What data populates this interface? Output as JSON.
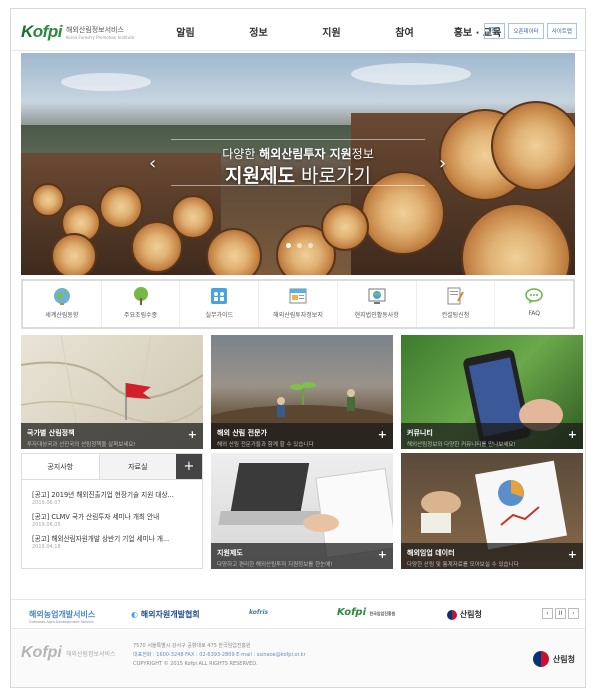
{
  "header": {
    "logo_word_k": "K",
    "logo_word_rest": "ofpi",
    "logo_sub1": "해외산림정보서비스",
    "logo_sub2": "Korea Forestry Promotion Institute",
    "menu": [
      "알림",
      "정보",
      "지원",
      "참여",
      "홍보 · 교육"
    ],
    "utils": [
      "ENG",
      "오픈데이터",
      "사이트맵"
    ]
  },
  "hero": {
    "line1_pre": "다양한 ",
    "line1_bold": "해외산림투자 지원",
    "line1_post": "정보",
    "line2_bold": "지원제도",
    "line2_post": " 바로가기",
    "prev": "‹",
    "next": "›"
  },
  "quick": [
    {
      "label": "세계산림동향",
      "icon": "globe-icon"
    },
    {
      "label": "주요조림수종",
      "icon": "tree-icon"
    },
    {
      "label": "실무가이드",
      "icon": "guide-people-icon"
    },
    {
      "label": "해외산림투자정보지",
      "icon": "newsletter-icon"
    },
    {
      "label": "현지법인활동사항",
      "icon": "local-office-icon"
    },
    {
      "label": "컨설팅신청",
      "icon": "consulting-icon"
    },
    {
      "label": "FAQ",
      "icon": "faq-bubble-icon"
    }
  ],
  "tiles": {
    "t1": {
      "title": "국가별 산림정책",
      "desc": "투자대상국과 선진국의 산림정책을 살펴보세요!"
    },
    "t2": {
      "title": "해외 산림 전문가",
      "desc": "해외 산림 전문가들과 함께 할 수 있습니다"
    },
    "t3": {
      "title": "커뮤니티",
      "desc": "해외산림정보와 다양한 커뮤니티를 만나보세요!"
    },
    "t4": {
      "title": "지원제도",
      "desc": "다양하고 편리한 해외산림투자 지원정보를 한눈에!"
    },
    "t5": {
      "title": "해외임업 데이터",
      "desc": "다양한 산림 및 통계자료를 모아보실 수 있습니다"
    },
    "plus": "+"
  },
  "notice": {
    "tab_on": "공지사항",
    "tab_off": "자료실",
    "plus": "+",
    "items": [
      {
        "title": "[공고] 2019년 해외진출기업 현장기술 지원 대상...",
        "date": "2019.06.07"
      },
      {
        "title": "[공고] CLMV 국가 산림투자 세미나 개최 안내",
        "date": "2019.06.05"
      },
      {
        "title": "[공고] 해외산림자원개발 상반기 기업 세미나 개...",
        "date": "2019.04.18"
      }
    ]
  },
  "partners": {
    "p1": "해외농업개발서비스",
    "p1_sub": "Overseas Agro-Development Service",
    "p2": "해외자원개발협회",
    "p3": "kofris",
    "p4": "Kofpi",
    "p4_sub": "한국임업진흥원",
    "p5": "산림청",
    "ctrl": [
      "‹",
      "II",
      "›"
    ]
  },
  "footer": {
    "logo_word": "Kofpi",
    "logo_sub": "해외산림정보서비스",
    "address": "7570 서울특별시 강서구 공항대로 475 한국임업진흥원",
    "tel": "대표전화 : 1600-3248 FAX : 02-6393-2809 E-mail : ssinaoe@kofpi.or.kr",
    "copyright": "COPYRIGHT © 2015 Kofpi ALL RIGHTS RESERVED.",
    "forest": "산림청"
  },
  "colors": {
    "brand_green": "#2a8a3e",
    "util_blue": "#2f5f9b",
    "caption_bg": "#191919"
  }
}
